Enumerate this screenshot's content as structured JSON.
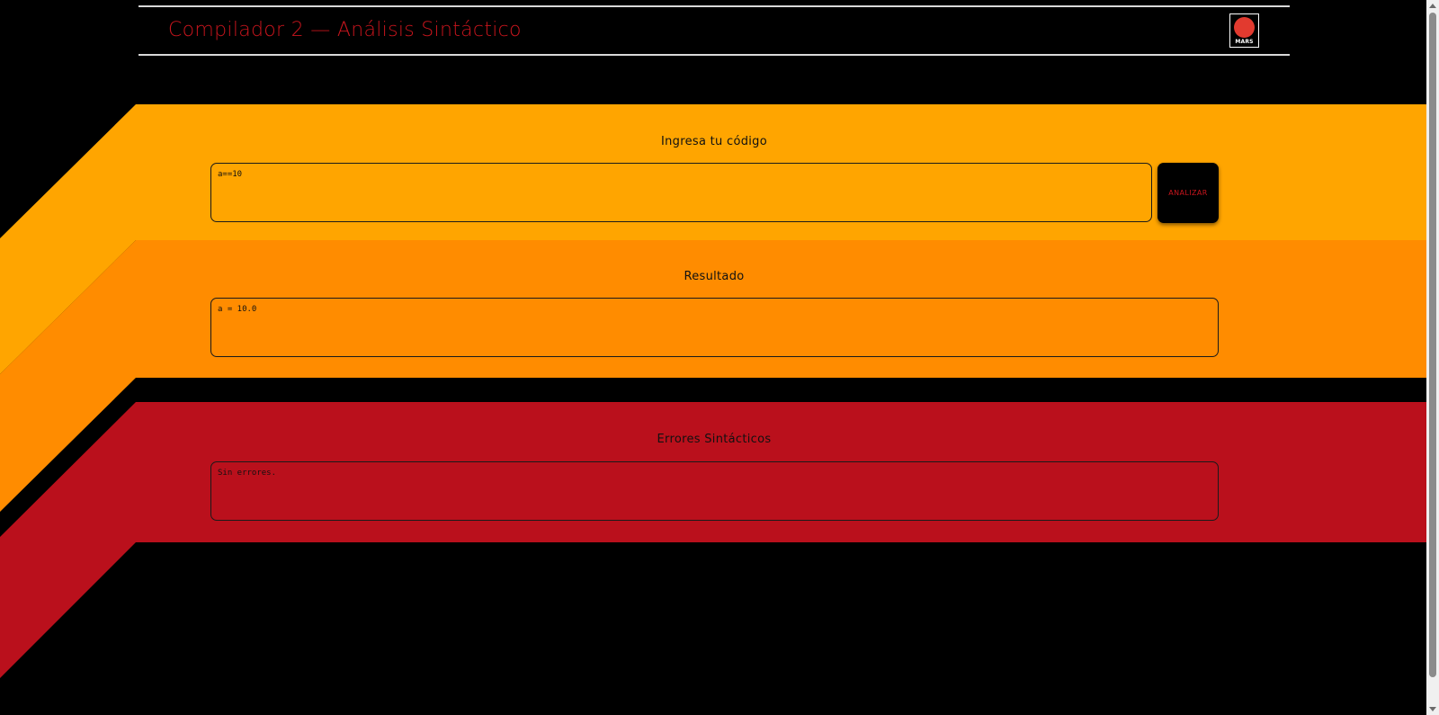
{
  "app": {
    "title": "Compilador 2 — Análisis Sintáctico",
    "logo_text": "MARS"
  },
  "input_section": {
    "label": "Ingresa tu código",
    "code_value": "a==10",
    "analyze_button_label": "ANALIZAR"
  },
  "result_section": {
    "label": "Resultado",
    "value": "a = 10.0"
  },
  "errors_section": {
    "label": "Errores Sintácticos",
    "value": "Sin errores."
  },
  "colors": {
    "background": "#000000",
    "stripe_yellow": "#ffa500",
    "stripe_orange": "#ff8c00",
    "stripe_red": "#ba101c",
    "accent_red": "#c8151d",
    "logo_red": "#e23a2f"
  }
}
